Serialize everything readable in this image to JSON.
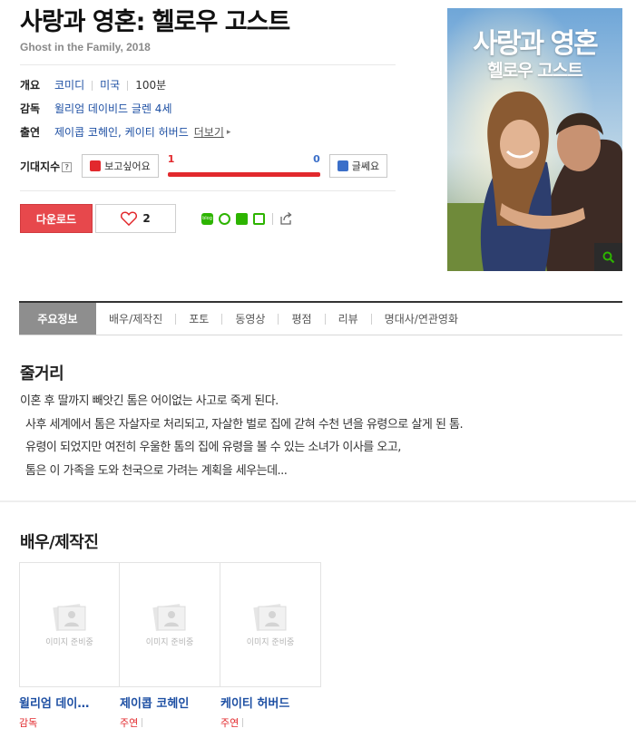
{
  "movie": {
    "title": "사랑과 영혼: 헬로우 고스트",
    "subtitle": "Ghost in the Family, 2018"
  },
  "info": {
    "overview_label": "개요",
    "overview": [
      "코미디",
      "미국",
      "100분"
    ],
    "director_label": "감독",
    "director": "윌리엄 데이비드 글렌 4세",
    "cast_label": "출연",
    "cast": "제이콥 코헤인, 케이티 허버드",
    "more": "더보기"
  },
  "rating": {
    "label": "기대지수",
    "help": "?",
    "want_label": "보고싶어요",
    "meh_label": "글쎄요",
    "want_count": "1",
    "meh_count": "0",
    "want_fraction": 1.0
  },
  "actions": {
    "download_label": "다운로드",
    "like_count": "2",
    "blog_icon_text": "blog"
  },
  "poster": {
    "title_line1": "사랑과 영혼",
    "title_line2": "헬로우 고스트"
  },
  "tabs": [
    "주요정보",
    "배우/제작진",
    "포토",
    "동영상",
    "평점",
    "리뷰",
    "명대사/연관영화"
  ],
  "synopsis": {
    "heading": "줄거리",
    "lines": [
      "이혼 후 딸까지 빼앗긴 톰은 어이없는 사고로 죽게 된다.",
      "사후 세계에서 톰은 자살자로 처리되고, 자살한 벌로 집에 갇혀 수천 년을 유령으로 살게 된 톰.",
      "유령이 되었지만 여전히 우울한 톰의 집에 유령을 볼 수 있는 소녀가 이사를 오고,",
      "톰은 이 가족을 도와 천국으로 가려는 계획을 세우는데..."
    ]
  },
  "crew": {
    "heading": "배우/제작진",
    "no_image": "이미지 준비중",
    "members": [
      {
        "name": "윌리엄 데이…",
        "role": "감독"
      },
      {
        "name": "제이콥 코헤인",
        "role": "주연"
      },
      {
        "name": "케이티 허버드",
        "role": "주연"
      }
    ]
  },
  "colors": {
    "accent_red": "#e7484c",
    "link_blue": "#1d4fa3",
    "naver_green": "#2db400"
  }
}
